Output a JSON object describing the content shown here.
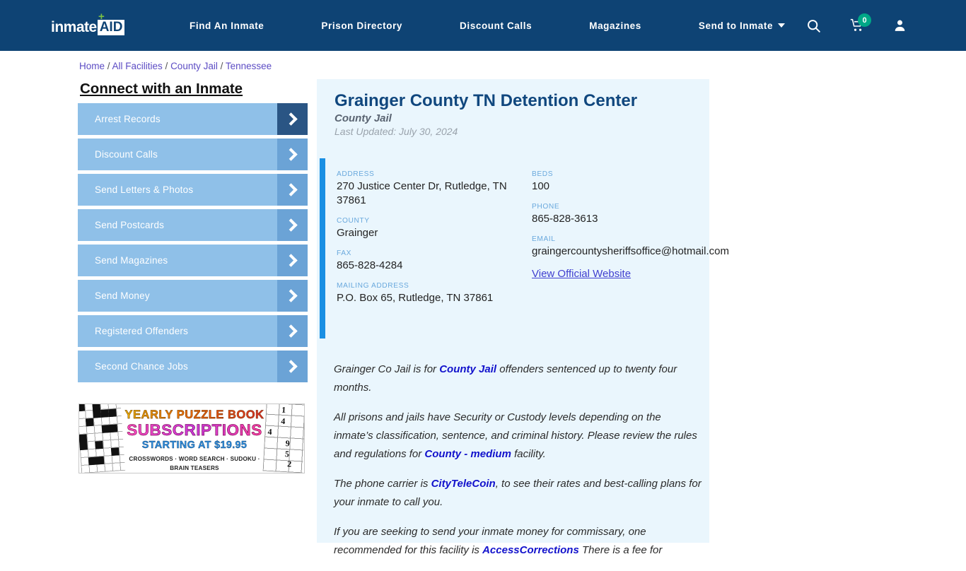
{
  "navbar": {
    "logo_primary": "inmate",
    "logo_secondary": "AID",
    "logo_plus": "+",
    "links": [
      {
        "label": "Find An Inmate"
      },
      {
        "label": "Prison Directory"
      },
      {
        "label": "Discount Calls"
      },
      {
        "label": "Magazines"
      },
      {
        "label": "Send to Inmate"
      }
    ],
    "cart_count": "0",
    "icons": [
      "search-icon",
      "cart-icon",
      "user-icon"
    ],
    "background_color": "#0e4374"
  },
  "breadcrumb": {
    "items": [
      {
        "label": "Home"
      },
      {
        "label": "All Facilities"
      },
      {
        "label": "County Jail"
      },
      {
        "label": "Tennessee"
      }
    ],
    "separator": "/"
  },
  "sidebar": {
    "heading": "Connect with an Inmate",
    "items": [
      {
        "label": "Arrest Records",
        "active": true
      },
      {
        "label": "Discount Calls",
        "active": false
      },
      {
        "label": "Send Letters & Photos",
        "active": false
      },
      {
        "label": "Send Postcards",
        "active": false
      },
      {
        "label": "Send Magazines",
        "active": false
      },
      {
        "label": "Send Money",
        "active": false
      },
      {
        "label": "Registered Offenders",
        "active": false
      },
      {
        "label": "Second Chance Jobs",
        "active": false
      }
    ]
  },
  "ad": {
    "line1": "YEARLY PUZZLE BOOK",
    "line2": "SUBSCRIPTIONS",
    "line3": "STARTING AT $19.95",
    "line4": "CROSSWORDS · WORD SEARCH · SUDOKU · BRAIN TEASERS",
    "sudoku_digits": [
      "1",
      "4",
      "4",
      "9",
      "5",
      "2"
    ]
  },
  "facility": {
    "title": "Grainger County TN Detention Center",
    "type": "County Jail",
    "last_updated": "Last Updated: July 30, 2024",
    "details_left": [
      {
        "label": "ADDRESS",
        "value": "270 Justice Center Dr, Rutledge, TN 37861"
      },
      {
        "label": "COUNTY",
        "value": "Grainger"
      },
      {
        "label": "FAX",
        "value": "865-828-4284"
      },
      {
        "label": "MAILING ADDRESS",
        "value": "P.O. Box 65, Rutledge, TN 37861"
      }
    ],
    "details_right": [
      {
        "label": "BEDS",
        "value": "100"
      },
      {
        "label": "PHONE",
        "value": "865-828-3613"
      },
      {
        "label": "EMAIL",
        "value": "graingercountysheriffsoffice@hotmail.com"
      }
    ],
    "website_link": "View Official Website"
  },
  "body": {
    "p1_a": "Grainger Co Jail is for ",
    "p1_link": "County Jail",
    "p1_b": " offenders sentenced up to twenty four months.",
    "p2_a": "All prisons and jails have Security or Custody levels depending on the inmate’s classification, sentence, and criminal history. Please review the rules and regulations for ",
    "p2_link": "County - medium",
    "p2_b": " facility.",
    "p3_a": "The phone carrier is ",
    "p3_link": "CityTeleCoin",
    "p3_b": ", to see their rates and best-calling plans for your inmate to call you.",
    "p4_a": "If you are seeking to send your inmate money for commissary, one recommended for this facility is ",
    "p4_link": "AccessCorrections",
    "p4_b": " There is a fee for"
  }
}
